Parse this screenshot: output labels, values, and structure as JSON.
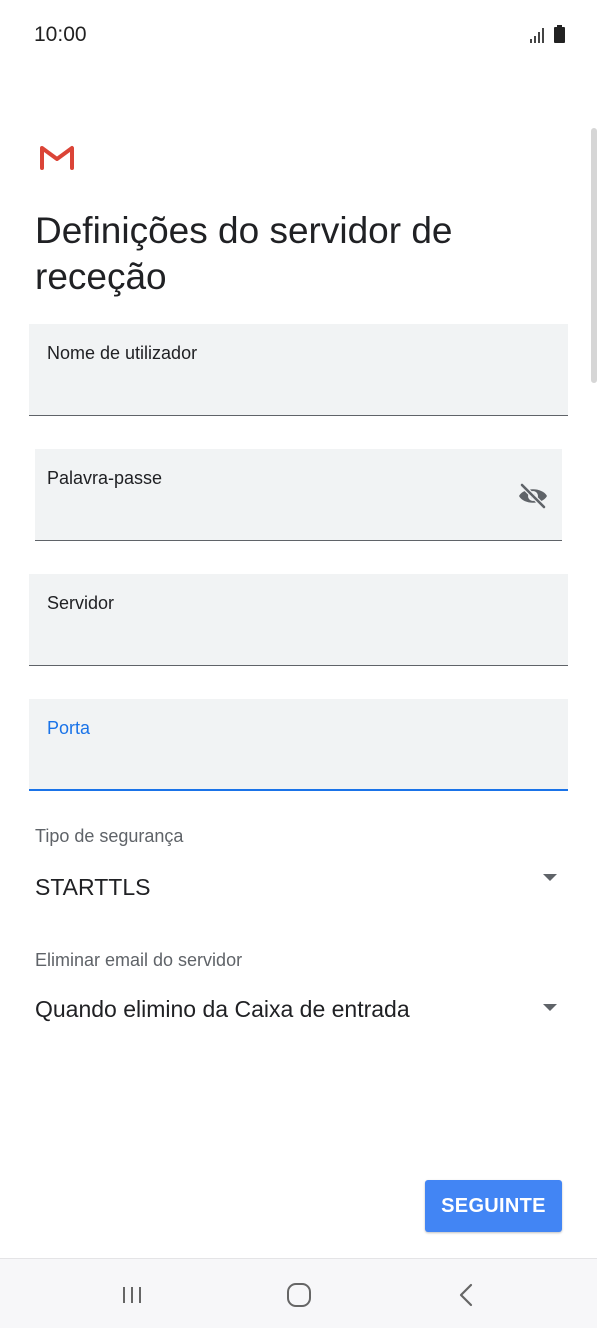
{
  "status_bar": {
    "time": "10:00"
  },
  "colors": {
    "accent": "#1a73e8",
    "button": "#4285f4",
    "field_bg": "#f1f3f4",
    "gmail_red": "#db4437"
  },
  "header": {
    "title": "Definições do servidor de receção"
  },
  "form": {
    "username": {
      "label": "Nome de utilizador",
      "value": ""
    },
    "password": {
      "label": "Palavra-passe",
      "value": "",
      "toggle_icon": "visibility-off-icon"
    },
    "server": {
      "label": "Servidor",
      "value": ""
    },
    "port": {
      "label": "Porta",
      "value": ""
    },
    "security_type": {
      "label": "Tipo de segurança",
      "value": "STARTTLS"
    },
    "delete_from_server": {
      "label": "Eliminar email do servidor",
      "value": "Quando elimino da Caixa de entrada"
    }
  },
  "actions": {
    "next_label": "SEGUINTE"
  },
  "nav": {
    "recents_icon": "recent-apps-icon",
    "home_icon": "home-icon",
    "back_icon": "back-icon"
  }
}
